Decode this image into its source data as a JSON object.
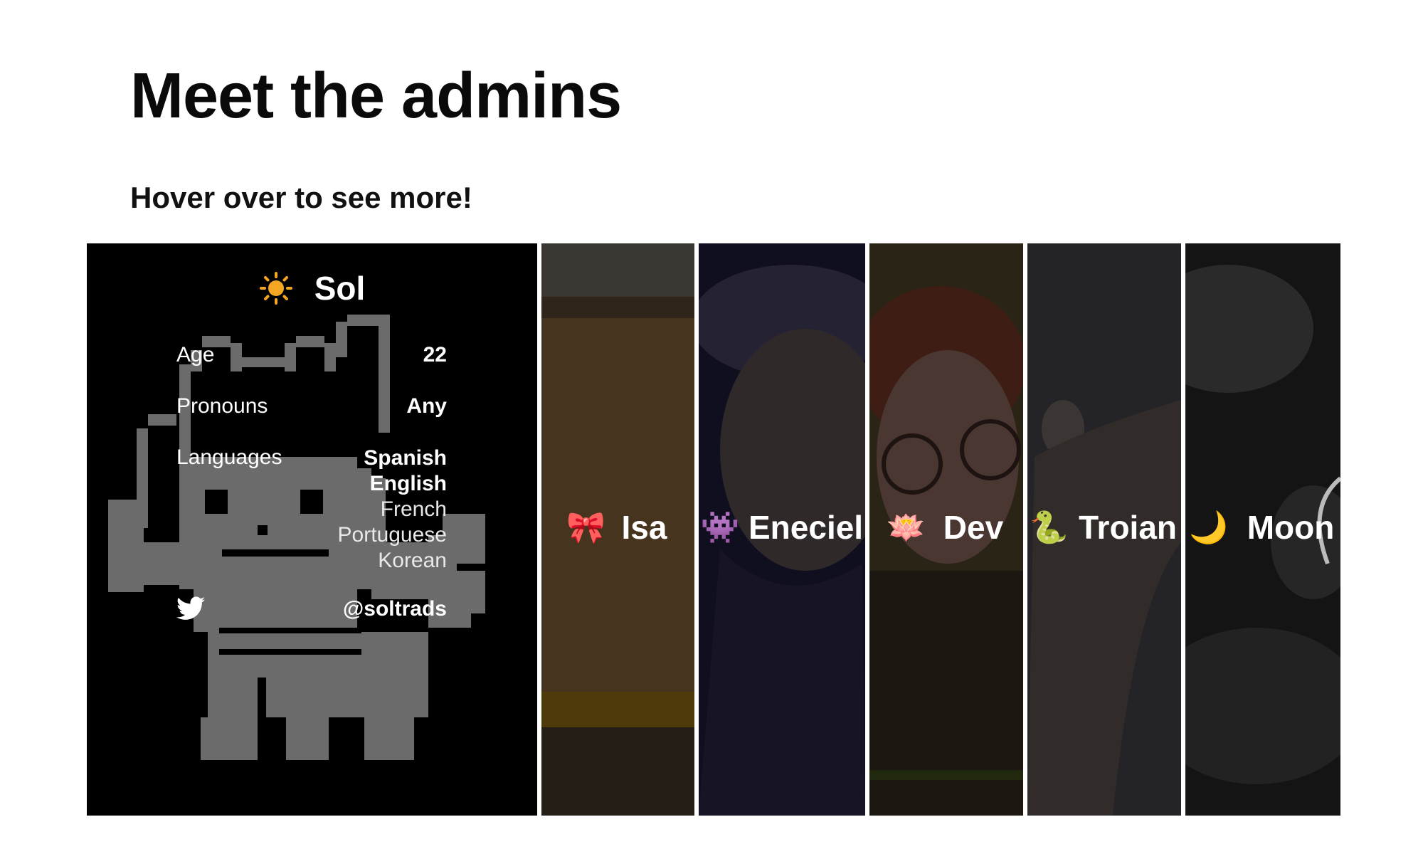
{
  "page": {
    "title": "Meet the admins",
    "subtitle": "Hover over to see more!"
  },
  "sol": {
    "name": "Sol",
    "icon": "sun-icon",
    "age_label": "Age",
    "age_value": "22",
    "pronouns_label": "Pronouns",
    "pronouns_value": "Any",
    "languages_label": "Languages",
    "languages": [
      "Spanish",
      "English",
      "French",
      "Portuguese",
      "Korean"
    ],
    "twitter_icon": "twitter-icon",
    "twitter_handle": "@soltrads"
  },
  "admins": [
    {
      "name": "Isa",
      "emoji": "🎀",
      "icon": "ribbon-icon"
    },
    {
      "name": "Eneciel",
      "emoji": "👾",
      "icon": "alien-monster-icon"
    },
    {
      "name": "Dev",
      "emoji": "🪷",
      "icon": "lotus-icon"
    },
    {
      "name": "Troian",
      "emoji": "🐍",
      "icon": "snake-icon"
    },
    {
      "name": "Moon",
      "emoji": "🌙",
      "icon": "crescent-moon-icon"
    }
  ],
  "colors": {
    "sun": "#f5a623",
    "sol_bg": "#000000",
    "cat_pixel": "#6b6b6b"
  }
}
